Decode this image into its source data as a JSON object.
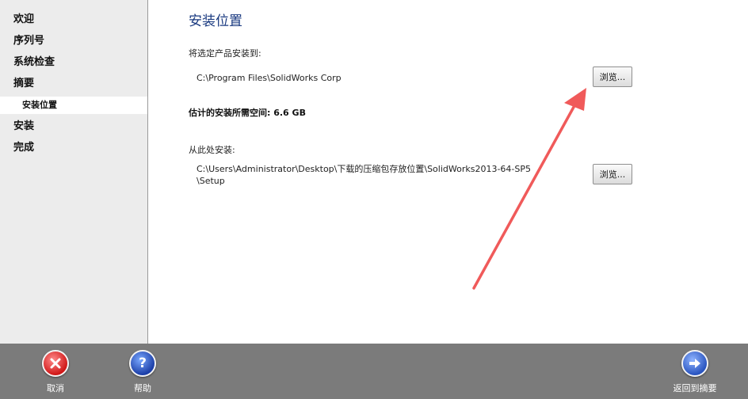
{
  "sidebar": {
    "items": [
      {
        "label": "欢迎"
      },
      {
        "label": "序列号"
      },
      {
        "label": "系统检查"
      },
      {
        "label": "摘要"
      },
      {
        "label": "安装位置"
      },
      {
        "label": "安装"
      },
      {
        "label": "完成"
      }
    ],
    "active_index": 4
  },
  "main": {
    "title": "安装位置",
    "install_to_label": "将选定产品安装到:",
    "install_path": "C:\\Program Files\\SolidWorks Corp",
    "browse_label_1": "浏览...",
    "space_required": "估计的安装所需空间: 6.6 GB",
    "install_from_label": "从此处安装:",
    "source_path_line1": "C:\\Users\\Administrator\\Desktop\\下载的压缩包存放位置\\SolidWorks2013-64-SP5",
    "source_path_line2": "\\Setup",
    "browse_label_2": "浏览..."
  },
  "bottom_bar": {
    "cancel_label": "取消",
    "help_label": "帮助",
    "back_label": "返回到摘要",
    "cancel_icon": "cancel-x-icon",
    "help_icon": "help-question-icon",
    "back_icon": "arrow-right-icon"
  },
  "colors": {
    "title": "#1a3a80",
    "bottom_bar": "#7b7b7b",
    "annotation_arrow": "#f05a5a"
  }
}
